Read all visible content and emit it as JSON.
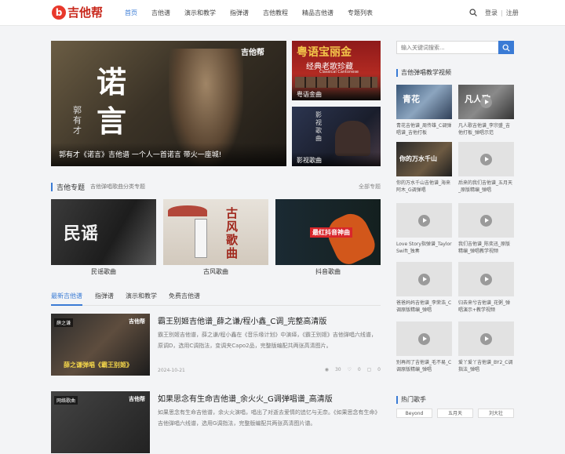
{
  "header": {
    "logo_mark": "b",
    "logo_text": "吉他帮",
    "nav": [
      "首页",
      "吉他谱",
      "演示和教学",
      "指弹谱",
      "吉他教程",
      "精品吉他谱",
      "专题列表"
    ],
    "active_nav": 0,
    "login": "登录",
    "register": "注册",
    "icon": "search-icon"
  },
  "banner": {
    "main": {
      "title_char1": "诺",
      "title_char2": "言",
      "artist_vertical": "郭有才",
      "watermark": "吉他帮",
      "caption": "郭有才《诺言》吉他谱 一个人一首诺言 带火一座城!"
    },
    "side": [
      {
        "title": "粤语宝丽金",
        "subtitle": "经典老歌珍藏",
        "small": "Classical Cantonese",
        "caption": "粤语金曲"
      },
      {
        "vertical": "影视歌曲",
        "caption": "影视歌曲"
      }
    ]
  },
  "topics": {
    "title": "吉他专题",
    "subtitle": "吉他弹唱歌曲分类专题",
    "more": "全部专题",
    "items": [
      {
        "label": "民谣歌曲",
        "art": "民谣"
      },
      {
        "label": "古风歌曲",
        "art": "古风歌曲"
      },
      {
        "label": "抖音歌曲",
        "art": "最红抖音神曲"
      }
    ]
  },
  "tabs": [
    "最新吉他谱",
    "指弹谱",
    "演示和教学",
    "免费吉他谱"
  ],
  "articles": [
    {
      "tag": "薛之谦",
      "watermark": "吉他帮",
      "thumb_caption": "薛之谦弹唱《霸王别姬》",
      "title": "霸王别姬吉他谱_薛之谦/程小鑫_C调_完整高清版",
      "desc": "霸王别姬吉他谱，薛之谦/程小鑫在《音乐缘计划》中演绎，《霸王别姬》吉他弹唱六线谱，原调D，选用C调指法，变调夹Capo2品，完整版编配共两张高清图片。",
      "date": "2024-10-21",
      "views": "30",
      "likes": "0",
      "comments": "0"
    },
    {
      "tag": "网络歌曲",
      "watermark": "吉他帮",
      "title": "如果思念有生命吉他谱_余火火_G调弹唱谱_高清版",
      "desc": "如果思念有生命吉他谱，余火火演唱，唱出了对逝去爱情的追忆与无奈。《如果思念有生命》吉他弹唱六线谱，选用G调指法，完整版编配共两张高清图片谱。"
    }
  ],
  "sidebar": {
    "search_placeholder": "输入关键词搜索...",
    "video_title": "吉他弹唱教学视频",
    "videos": [
      {
        "caption": "青花吉他谱_周传雄_C调弹唱谱_吉他打板",
        "overlay": "青花"
      },
      {
        "caption": "凡人歌吉他谱_李宗盛_吉他打板_弹唱示范",
        "overlay": "凡人歌"
      },
      {
        "caption": "你的万水千山吉他谱_海来阿木_G调弹唱",
        "overlay": "你的万水千山"
      },
      {
        "caption": "后来的我们吉他谱_五月天_原版精编_弹唱"
      },
      {
        "caption": "Love Story指弹谱_Taylor Swift_独奏"
      },
      {
        "caption": "我们吉他谱_陈奕迅_原版精编_弹唱教学视频"
      },
      {
        "caption": "爸爸妈妈吉他谱_李荣浩_C调原版精编_弹唱"
      },
      {
        "caption": "归去来兮吉他谱_花粥_弹唱演示+教学视频"
      },
      {
        "caption": "别再闹了吉他谱_毛不易_C调原版精编_弹唱"
      },
      {
        "caption": "爱丫爱丫吉他谱_BY2_C调指法_弹唱"
      }
    ],
    "singers_title": "热门歌手",
    "singers": [
      "Beyond",
      "五月天",
      "刘大壮"
    ]
  }
}
